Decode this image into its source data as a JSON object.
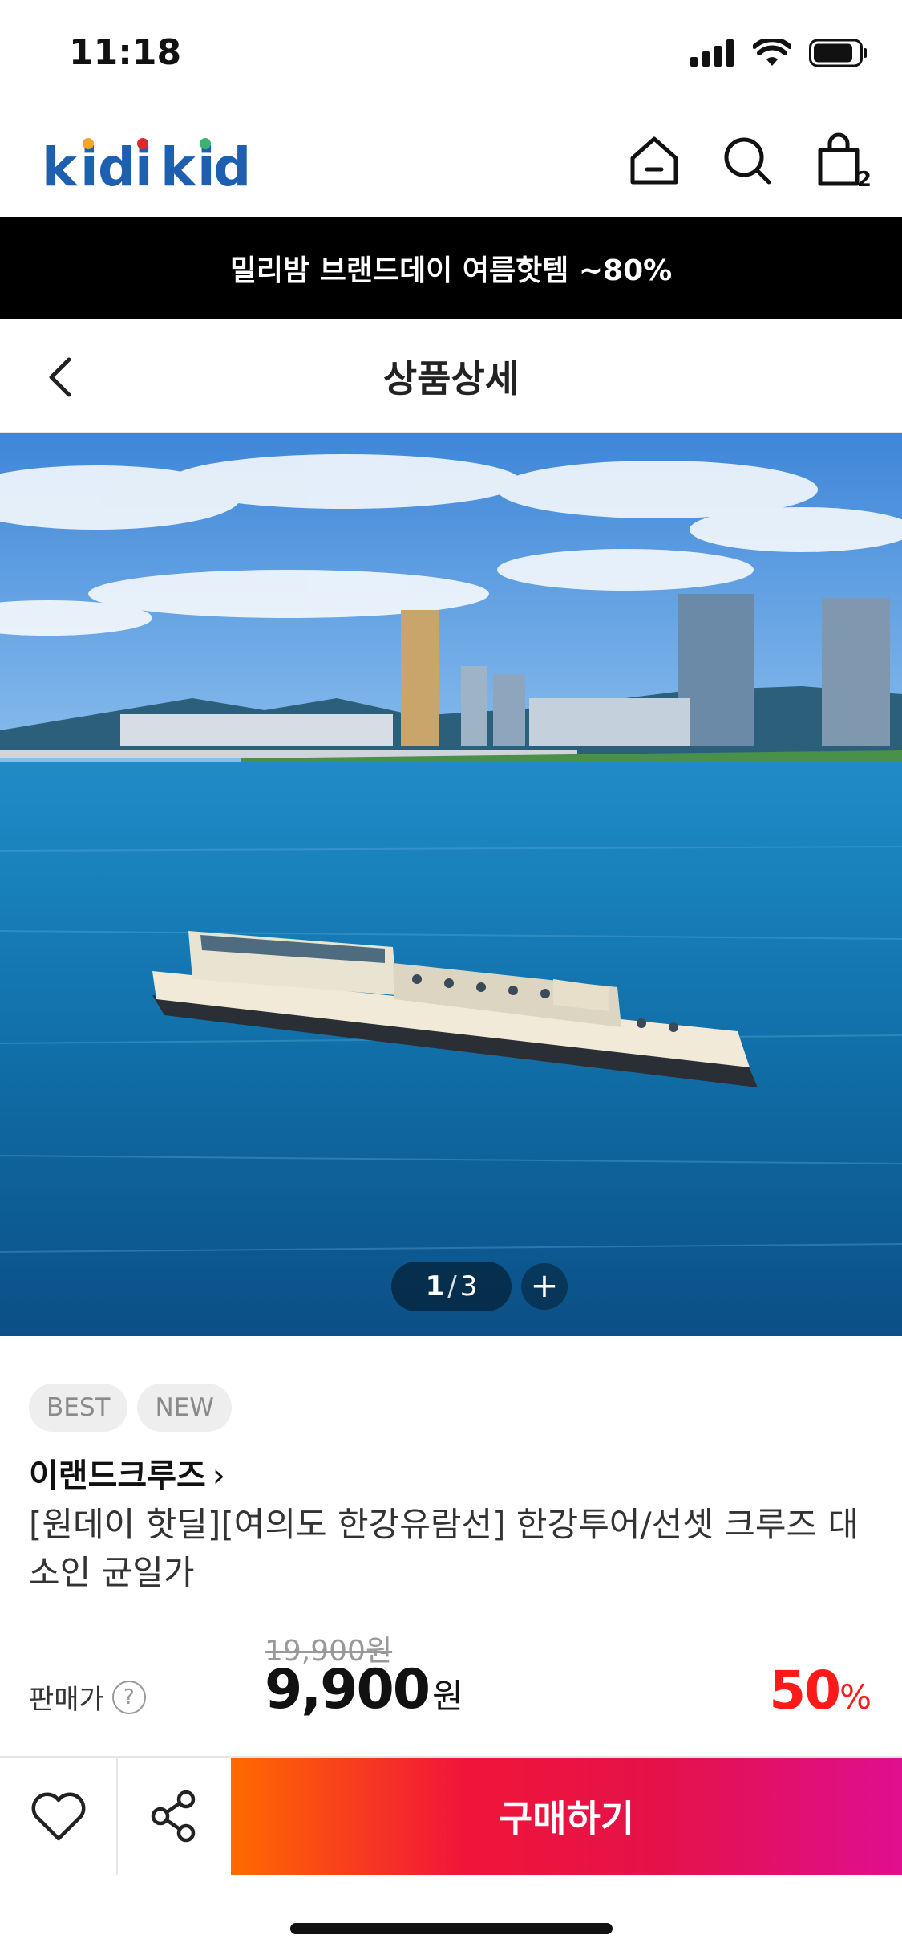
{
  "status_bar": {
    "time": "11:18"
  },
  "header": {
    "logo": "kidikidi",
    "cart_count": "2"
  },
  "promo_banner": {
    "text": "밀리밤 브랜드데이 여름핫템 ~80%"
  },
  "subheader": {
    "title": "상품상세"
  },
  "gallery": {
    "current": "1",
    "separator": "/",
    "total": "3",
    "more": "+"
  },
  "product": {
    "badges": [
      "BEST",
      "NEW"
    ],
    "brand": "이랜드크루즈",
    "brand_chevron": "›",
    "title": "[원데이 핫딜][여의도 한강유람선] 한강투어/선셋 크루즈 대소인 균일가",
    "price_label": "판매가",
    "help": "?",
    "original_price": "19,900원",
    "sale_price": "9,900",
    "currency": "원",
    "discount": "50",
    "discount_unit": "%"
  },
  "bottom_bar": {
    "buy_label": "구매하기"
  },
  "colors": {
    "accent_red": "#ff1a1a",
    "buy_gradient_start": "#ff6a00",
    "buy_gradient_end": "#df0f8f",
    "logo_blue": "#1f5fb0"
  }
}
